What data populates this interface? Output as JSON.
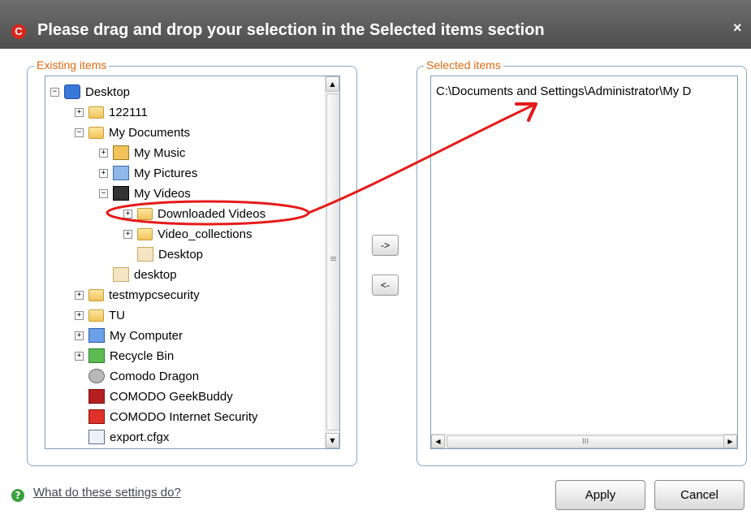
{
  "window": {
    "title": "Please drag and drop your selection in the Selected items section",
    "app_icon_letter": "C",
    "close_glyph": "×"
  },
  "existing": {
    "legend": "Existing items",
    "tree": [
      {
        "label": "Desktop",
        "icon": "desktop-icon",
        "expander": "−"
      },
      {
        "label": "122111",
        "icon": "folder-icon",
        "expander": "+"
      },
      {
        "label": "My Documents",
        "icon": "folder-icon",
        "expander": "−"
      },
      {
        "label": "My Music",
        "icon": "music-folder-icon",
        "expander": "+"
      },
      {
        "label": "My Pictures",
        "icon": "pictures-folder-icon",
        "expander": "+"
      },
      {
        "label": "My Videos",
        "icon": "videos-folder-icon",
        "expander": "−"
      },
      {
        "label": "Downloaded Videos",
        "icon": "folder-icon",
        "expander": "+"
      },
      {
        "label": "Video_collections",
        "icon": "folder-icon",
        "expander": "+"
      },
      {
        "label": "Desktop",
        "icon": "shortcut-icon",
        "expander": ""
      },
      {
        "label": "desktop",
        "icon": "shortcut-icon",
        "expander": ""
      },
      {
        "label": "testmypcsecurity",
        "icon": "folder-icon",
        "expander": "+"
      },
      {
        "label": "TU",
        "icon": "folder-icon",
        "expander": "+"
      },
      {
        "label": "My Computer",
        "icon": "computer-icon",
        "expander": "+"
      },
      {
        "label": "Recycle Bin",
        "icon": "recycle-bin-icon",
        "expander": "+"
      },
      {
        "label": "Comodo Dragon",
        "icon": "comodo-dragon-icon",
        "expander": ""
      },
      {
        "label": "COMODO GeekBuddy",
        "icon": "geekbuddy-icon",
        "expander": ""
      },
      {
        "label": "COMODO Internet Security",
        "icon": "cis-icon",
        "expander": ""
      },
      {
        "label": "export.cfgx",
        "icon": "cfg-file-icon",
        "expander": ""
      }
    ]
  },
  "selected": {
    "legend": "Selected items",
    "items": [
      "C:\\Documents and Settings\\Administrator\\My D"
    ]
  },
  "buttons": {
    "add": "->",
    "remove": "<-",
    "apply": "Apply",
    "cancel": "Cancel"
  },
  "help": {
    "link": "What do these settings do?",
    "icon_glyph": "?"
  },
  "scroll": {
    "up": "▲",
    "down": "▼",
    "left": "◀",
    "right": "▶",
    "grip_v": "≡",
    "grip_h": "III"
  },
  "colors": {
    "titlebar": "#5a5a5a",
    "legend_text": "#e06a10",
    "groupbox_border": "#8aa6c8",
    "annotation": "#e51a1a"
  }
}
